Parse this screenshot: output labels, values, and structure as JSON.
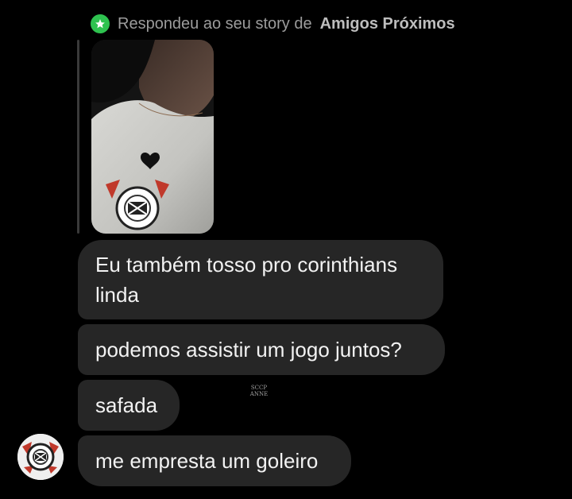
{
  "story_reply": {
    "prefix": "Respondeu ao seu story de",
    "list_name": "Amigos Próximos",
    "badge_icon": "star-icon",
    "badge_color": "#2ec24f"
  },
  "story_thumbnail": {
    "icon": "black-heart-icon"
  },
  "messages": [
    {
      "text": "Eu também tosso pro corinthians linda"
    },
    {
      "text": "podemos assistir um jogo juntos?"
    },
    {
      "text": "safada"
    },
    {
      "text": "me empresta um goleiro"
    }
  ],
  "watermark": {
    "line1": "SCCP",
    "line2": "ANNE"
  },
  "sender": {
    "avatar_icon": "corinthians-crest-avatar"
  },
  "colors": {
    "background": "#000000",
    "bubble": "#262626",
    "bubble_text": "#f2f2f2",
    "header_text": "#9c9c9c"
  }
}
